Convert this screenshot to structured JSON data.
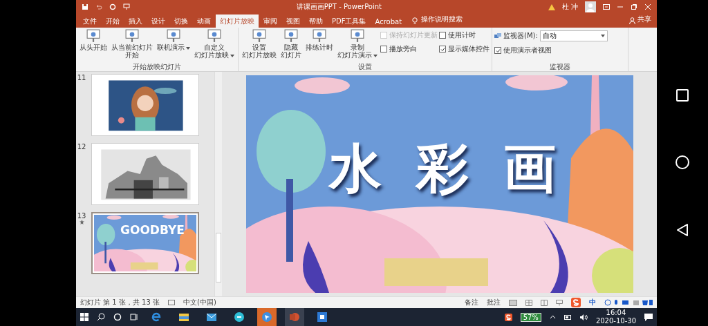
{
  "window": {
    "title": "讲课画画PPT - PowerPoint",
    "user": "杜 冲"
  },
  "tabs": [
    {
      "label": "文件",
      "selected": false
    },
    {
      "label": "开始",
      "selected": false
    },
    {
      "label": "插入",
      "selected": false
    },
    {
      "label": "设计",
      "selected": false
    },
    {
      "label": "切换",
      "selected": false
    },
    {
      "label": "动画",
      "selected": false
    },
    {
      "label": "幻灯片放映",
      "selected": true
    },
    {
      "label": "审阅",
      "selected": false
    },
    {
      "label": "视图",
      "selected": false
    },
    {
      "label": "帮助",
      "selected": false
    },
    {
      "label": "PDF工具集",
      "selected": false
    },
    {
      "label": "Acrobat",
      "selected": false
    }
  ],
  "tell_me": "操作说明搜索",
  "share": "共享",
  "ribbon": {
    "start_group": {
      "label": "开始放映幻灯片",
      "buttons": [
        {
          "lines": [
            "从头开始"
          ],
          "dropdown": false
        },
        {
          "lines": [
            "从当前幻灯片",
            "开始"
          ],
          "dropdown": false
        },
        {
          "lines": [
            "联机演示"
          ],
          "dropdown": true
        },
        {
          "lines": [
            "自定义",
            "幻灯片放映"
          ],
          "dropdown": true
        }
      ]
    },
    "setup_group": {
      "label": "设置",
      "buttons": [
        {
          "lines": [
            "设置",
            "幻灯片放映"
          ],
          "dropdown": false
        },
        {
          "lines": [
            "隐藏",
            "幻灯片"
          ],
          "dropdown": false
        },
        {
          "lines": [
            "排练计时"
          ],
          "dropdown": false
        },
        {
          "lines": [
            "录制",
            "幻灯片演示"
          ],
          "dropdown": true
        }
      ],
      "checkboxes": [
        {
          "label": "保持幻灯片更新",
          "checked": false,
          "disabled": true
        },
        {
          "label": "播放旁白",
          "checked": false,
          "disabled": false
        },
        {
          "label": "使用计时",
          "checked": false,
          "disabled": false
        },
        {
          "label": "显示媒体控件",
          "checked": true,
          "disabled": false
        }
      ]
    },
    "monitor_group": {
      "label": "监视器",
      "monitor_label": "监视器(M):",
      "monitor_value": "自动",
      "presenter_view": {
        "label": "使用演示者视图",
        "checked": true
      }
    }
  },
  "slides": [
    {
      "number": "11",
      "selected": false,
      "animated": false
    },
    {
      "number": "12",
      "selected": false,
      "animated": false
    },
    {
      "number": "13",
      "selected": true,
      "animated": true,
      "title": "GOODBYE"
    }
  ],
  "current_slide": {
    "title": "水 彩 画"
  },
  "status_bar": {
    "position": "幻灯片 第 1 张，共 13 张",
    "language": "中文(中国)",
    "notes": "备注",
    "comments": "批注",
    "ime": "中"
  },
  "taskbar": {
    "battery": "57%",
    "time": "16:04",
    "date": "2020-10-30"
  }
}
